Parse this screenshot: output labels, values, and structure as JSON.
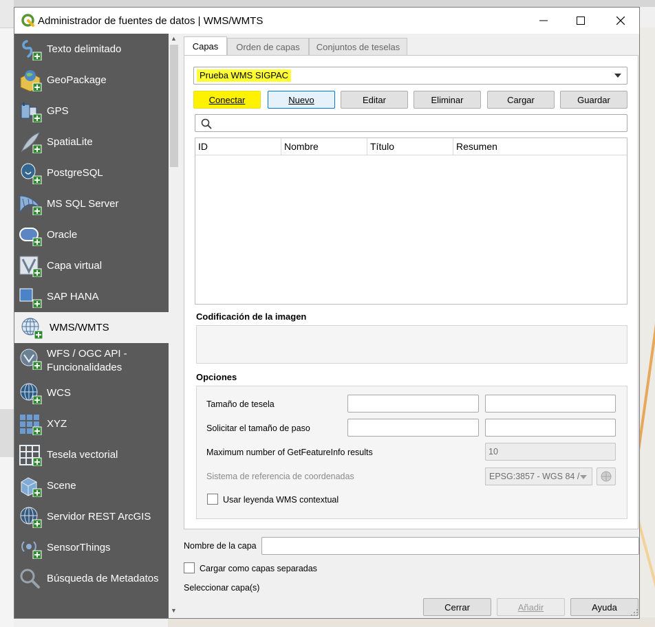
{
  "window": {
    "title": "Administrador de fuentes de datos | WMS/WMTS",
    "minimize_glyph": "—",
    "maximize_glyph": "☐",
    "close_glyph": "✕"
  },
  "sidebar": {
    "items": [
      {
        "label": "Texto delimitado",
        "icon": "delimited-text-icon"
      },
      {
        "label": "GeoPackage",
        "icon": "geopackage-icon"
      },
      {
        "label": "GPS",
        "icon": "gps-icon"
      },
      {
        "label": "SpatiaLite",
        "icon": "spatialite-icon"
      },
      {
        "label": "PostgreSQL",
        "icon": "postgresql-icon"
      },
      {
        "label": "MS SQL Server",
        "icon": "mssql-icon"
      },
      {
        "label": "Oracle",
        "icon": "oracle-icon"
      },
      {
        "label": "Capa virtual",
        "icon": "virtual-layer-icon"
      },
      {
        "label": "SAP HANA",
        "icon": "sap-hana-icon"
      },
      {
        "label": "WMS/WMTS",
        "icon": "wms-icon",
        "selected": true
      },
      {
        "label": "WFS / OGC API -",
        "label2": "Funcionalidades",
        "icon": "wfs-icon"
      },
      {
        "label": "WCS",
        "icon": "wcs-icon"
      },
      {
        "label": "XYZ",
        "icon": "xyz-icon"
      },
      {
        "label": "Tesela vectorial",
        "icon": "vector-tile-icon"
      },
      {
        "label": "Scene",
        "icon": "scene-icon"
      },
      {
        "label": "Servidor REST ArcGIS",
        "icon": "arcgis-rest-icon"
      },
      {
        "label": "SensorThings",
        "icon": "sensorthings-icon"
      },
      {
        "label": "Búsqueda de Metadatos",
        "icon": "metadata-search-icon"
      }
    ]
  },
  "tabs": [
    "Capas",
    "Orden de capas",
    "Conjuntos de teselas"
  ],
  "connection": {
    "selected": "Prueba WMS SIGPAC"
  },
  "buttons": {
    "connect": "Conectar",
    "new": "Nuevo",
    "edit": "Editar",
    "delete": "Eliminar",
    "load": "Cargar",
    "save": "Guardar"
  },
  "search": {
    "placeholder": ""
  },
  "table": {
    "headers": [
      "ID",
      "Nombre",
      "Título",
      "Resumen"
    ],
    "rows": []
  },
  "image_encoding": {
    "title": "Codificación de la imagen"
  },
  "options": {
    "title": "Opciones",
    "tile_size_label": "Tamaño de tesela",
    "step_size_label": "Solicitar el tamaño de paso",
    "max_feature_info_label": "Maximum number of GetFeatureInfo results",
    "max_feature_info_value": "10",
    "crs_label": "Sistema de referencia de coordenadas",
    "crs_value": "EPSG:3857 - WGS 84 /",
    "contextual_legend_label": "Usar leyenda WMS contextual"
  },
  "layer_name_label": "Nombre de la capa",
  "load_separate_label": "Cargar como capas separadas",
  "select_layers_label": "Seleccionar capa(s)",
  "footer": {
    "close": "Cerrar",
    "add": "Añadir",
    "help": "Ayuda"
  },
  "colors": {
    "highlight": "#ffff33",
    "sidebar": "#5a5a5a",
    "qgis_green": "#589632"
  }
}
